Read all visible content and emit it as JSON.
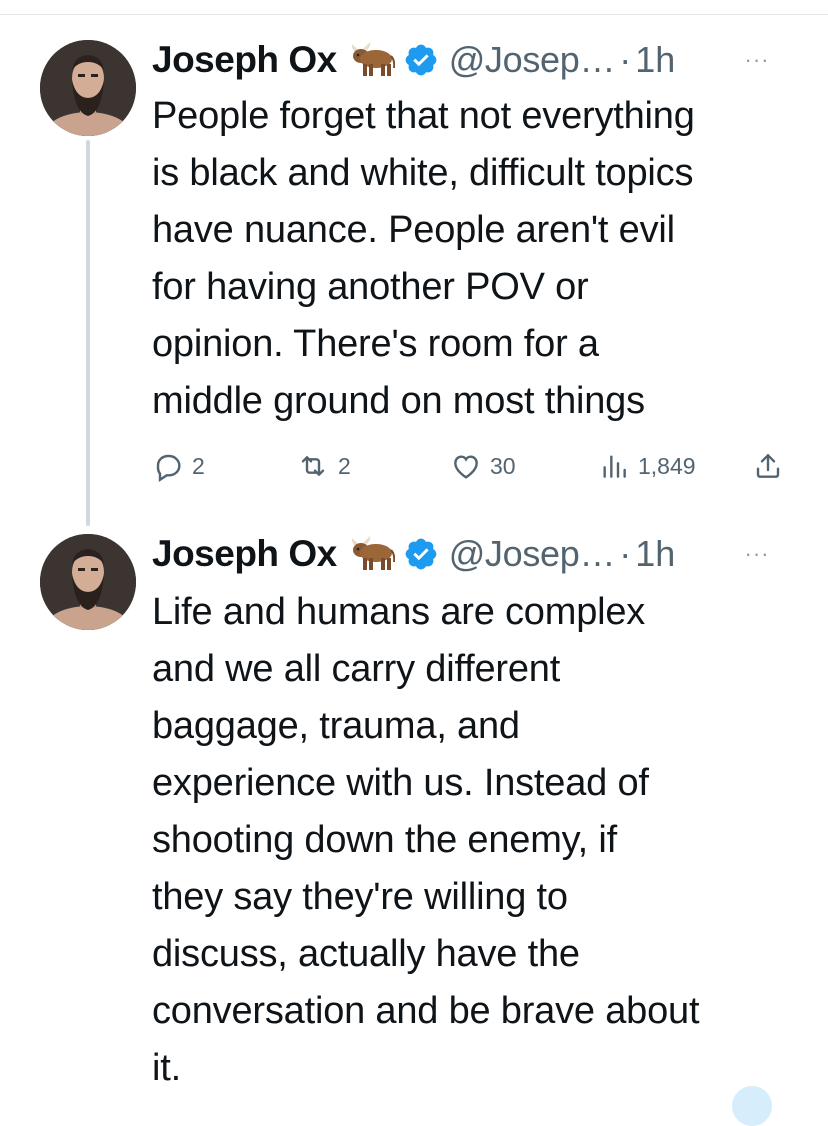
{
  "colors": {
    "verified": "#1d9bf0",
    "text": "#0f1419",
    "secondary": "#536471",
    "thread_line": "#cfd9de"
  },
  "tweets": [
    {
      "author": {
        "name": "Joseph Ox",
        "emoji": "🐂",
        "handle": "@Josep…",
        "time": "1h",
        "verified": true
      },
      "separator": "·",
      "more_label": "···",
      "text": "People forget that not everything\nis black and white, difficult topics\nhave nuance. People aren't evil\nfor having another POV or\nopinion. There's room for a\nmiddle ground on most things",
      "stats": {
        "replies": "2",
        "reposts": "2",
        "likes": "30",
        "views": "1,849"
      },
      "icons": [
        "reply-icon",
        "repost-icon",
        "like-icon",
        "views-icon",
        "share-icon"
      ]
    },
    {
      "author": {
        "name": "Joseph Ox",
        "emoji": "🐂",
        "handle": "@Josep…",
        "time": "1h",
        "verified": true
      },
      "separator": "·",
      "more_label": "···",
      "text": "Life and humans are complex\nand we all carry different\nbaggage, trauma, and\nexperience with us. Instead of\nshooting down the enemy, if\nthey say they're willing to\ndiscuss, actually have the\nconversation and be brave about\nit."
    }
  ]
}
